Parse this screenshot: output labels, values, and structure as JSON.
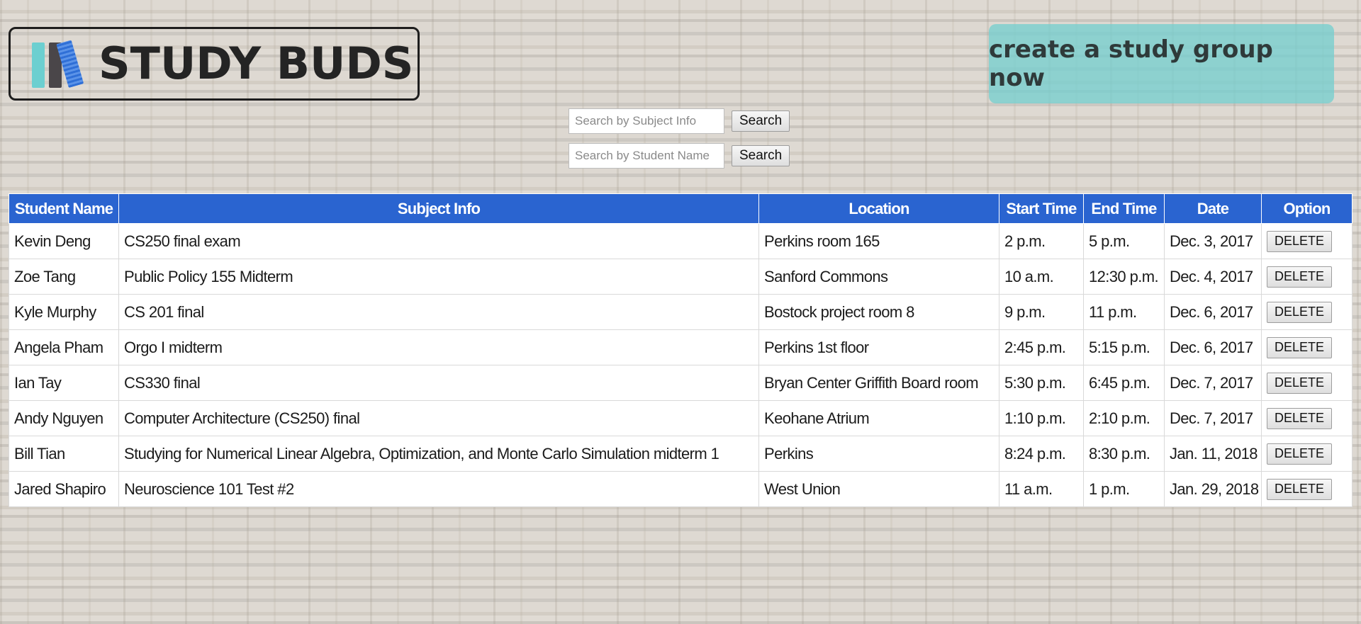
{
  "header": {
    "logo_text": "STUDY BUDS",
    "cta_label": "create a study group now"
  },
  "search": {
    "subject_placeholder": "Search by Subject Info",
    "student_placeholder": "Search by Student Name",
    "subject_button": "Search",
    "student_button": "Search"
  },
  "table": {
    "headers": [
      "Student Name",
      "Subject Info",
      "Location",
      "Start Time",
      "End Time",
      "Date",
      "Option"
    ],
    "rows": [
      {
        "student": "Kevin Deng",
        "subject": "CS250 final exam",
        "location": "Perkins room 165",
        "start": "2 p.m.",
        "end": "5 p.m.",
        "date": "Dec. 3, 2017",
        "option": "DELETE"
      },
      {
        "student": "Zoe Tang",
        "subject": "Public Policy 155 Midterm",
        "location": "Sanford Commons",
        "start": "10 a.m.",
        "end": "12:30 p.m.",
        "date": "Dec. 4, 2017",
        "option": "DELETE"
      },
      {
        "student": "Kyle Murphy",
        "subject": "CS 201 final",
        "location": "Bostock project room 8",
        "start": "9 p.m.",
        "end": "11 p.m.",
        "date": "Dec. 6, 2017",
        "option": "DELETE"
      },
      {
        "student": "Angela Pham",
        "subject": "Orgo I midterm",
        "location": "Perkins 1st floor",
        "start": "2:45 p.m.",
        "end": "5:15 p.m.",
        "date": "Dec. 6, 2017",
        "option": "DELETE"
      },
      {
        "student": "Ian Tay",
        "subject": "CS330 final",
        "location": "Bryan Center Griffith Board room",
        "start": "5:30 p.m.",
        "end": "6:45 p.m.",
        "date": "Dec. 7, 2017",
        "option": "DELETE"
      },
      {
        "student": "Andy Nguyen",
        "subject": "Computer Architecture (CS250) final",
        "location": "Keohane Atrium",
        "start": "1:10 p.m.",
        "end": "2:10 p.m.",
        "date": "Dec. 7, 2017",
        "option": "DELETE"
      },
      {
        "student": "Bill Tian",
        "subject": "Studying for Numerical Linear Algebra, Optimization, and Monte Carlo Simulation midterm 1",
        "location": "Perkins",
        "start": "8:24 p.m.",
        "end": "8:30 p.m.",
        "date": "Jan. 11, 2018",
        "option": "DELETE"
      },
      {
        "student": "Jared Shapiro",
        "subject": "Neuroscience 101 Test #2",
        "location": "West Union",
        "start": "11 a.m.",
        "end": "1 p.m.",
        "date": "Jan. 29, 2018",
        "option": "DELETE"
      }
    ]
  },
  "colors": {
    "table_header": "#2a64d0",
    "cta_background": "#76cece",
    "logo_book_teal": "#6ccfd0",
    "logo_book_dark": "#4a4649",
    "logo_book_blue": "#2f6fd6"
  }
}
